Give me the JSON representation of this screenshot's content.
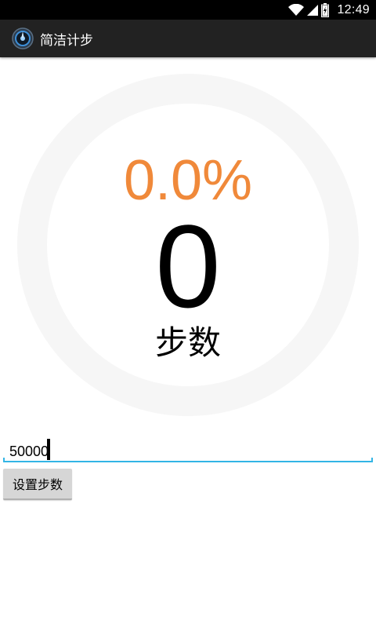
{
  "status_bar": {
    "time": "12:49",
    "icons": [
      "wifi-icon",
      "cell-signal-icon",
      "battery-icon"
    ]
  },
  "action_bar": {
    "title": "简洁计步",
    "icon": "app-logo-icon"
  },
  "progress": {
    "percent_text": "0.0%",
    "percent_value": 0.0,
    "percent_color": "#f0893a",
    "ring_color": "#f6f6f6"
  },
  "steps": {
    "count": "0",
    "label": "步数"
  },
  "goal": {
    "value": "50000",
    "underline_color": "#33b5e5"
  },
  "set_button": {
    "label": "设置步数"
  }
}
